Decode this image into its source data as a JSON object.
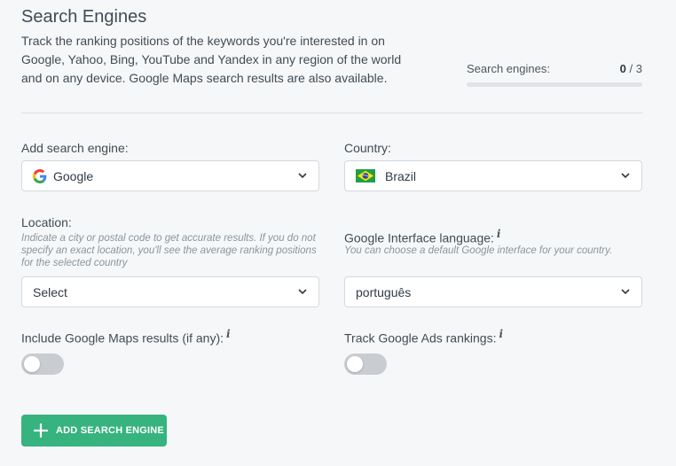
{
  "header": {
    "title": "Search Engines",
    "description": "Track the ranking positions of the keywords you're interested in on Google, Yahoo, Bing, YouTube and Yandex in any region of the world and on any device. Google Maps search results are also available."
  },
  "counter": {
    "label": "Search engines:",
    "used": "0",
    "total": "/ 3",
    "progress_fraction": 0
  },
  "form": {
    "search_engine": {
      "label": "Add search engine:",
      "value": "Google",
      "icon": "google-g-icon"
    },
    "country": {
      "label": "Country:",
      "value": "Brazil",
      "icon": "brazil-flag-icon"
    },
    "location": {
      "label": "Location:",
      "hint": "Indicate a city or postal code to get accurate results. If you do not specify an exact location, you'll see the average ranking positions for the selected country",
      "value": "Select"
    },
    "interface_language": {
      "label": "Google Interface language:",
      "info": "i",
      "hint": "You can choose a default Google interface for your country.",
      "value": "português"
    },
    "maps_results": {
      "label": "Include Google Maps results (if any):",
      "info": "i",
      "enabled": false
    },
    "ads_rankings": {
      "label": "Track Google Ads rankings:",
      "info": "i",
      "enabled": false
    }
  },
  "actions": {
    "add_label": "ADD SEARCH ENGINE",
    "accent_color": "#36b37e"
  }
}
